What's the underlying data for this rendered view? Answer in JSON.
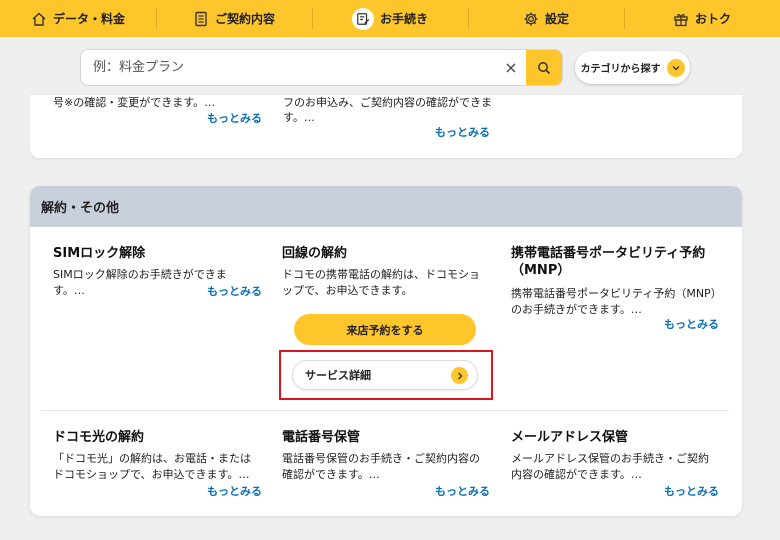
{
  "nav": {
    "items": [
      {
        "label": "データ・料金",
        "icon": "home-icon"
      },
      {
        "label": "ご契約内容",
        "icon": "document-icon"
      },
      {
        "label": "お手続き",
        "icon": "edit-note-icon",
        "active": true
      },
      {
        "label": "設定",
        "icon": "gear-icon"
      },
      {
        "label": "おトク",
        "icon": "gift-icon"
      }
    ]
  },
  "search": {
    "placeholder": "例：料金プラン",
    "clear_glyph": "×",
    "category_label": "カテゴリから探す"
  },
  "cut_card": {
    "items": [
      {
        "desc": "号※の確認・変更ができます。…",
        "more": "もっとみる"
      },
      {
        "desc_line1": "フのお申込み、ご契約内容の確認ができま",
        "desc_line2": "す。…",
        "more": "もっとみる"
      }
    ]
  },
  "section": {
    "title": "解約・その他",
    "items": [
      {
        "title": "SIMロック解除",
        "desc": "SIMロック解除のお手続きができます。…",
        "more": "もっとみる"
      },
      {
        "title": "回線の解約",
        "desc": "ドコモの携帯電話の解約は、ドコモショップで、お申込できます。",
        "primary_button": "来店予約をする",
        "secondary_button": "サービス詳細"
      },
      {
        "title": "携帯電話番号ポータビリティ予約（MNP）",
        "desc": "携帯電話番号ポータビリティ予約（MNP）のお手続きができます。…",
        "more": "もっとみる"
      },
      {
        "title": "ドコモ光の解約",
        "desc": "「ドコモ光」の解約は、お電話・またはドコモショップで、お申込できます。…",
        "more": "もっとみる"
      },
      {
        "title": "電話番号保管",
        "desc": "電話番号保管のお手続き・ご契約内容の確認ができます。…",
        "more": "もっとみる"
      },
      {
        "title": "メールアドレス保管",
        "desc": "メールアドレス保管のお手続き・ご契約内容の確認ができます。…",
        "more": "もっとみる"
      }
    ]
  },
  "colors": {
    "accent": "#ffc62b",
    "link": "#0a6fb8",
    "highlight": "#e0141d",
    "section_header": "#c8d0dc"
  }
}
